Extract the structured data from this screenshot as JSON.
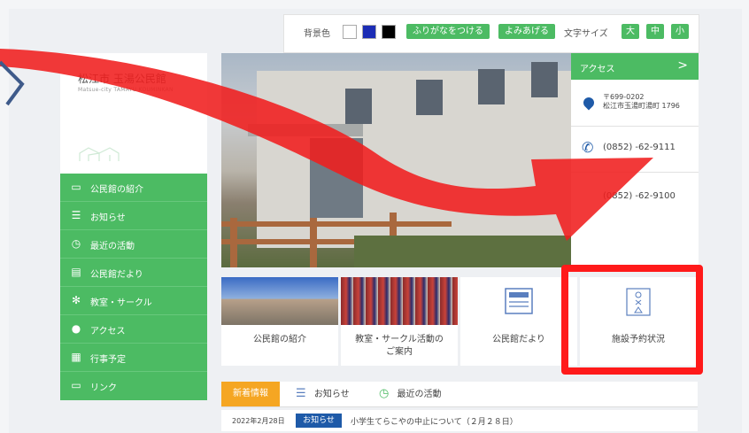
{
  "toolbar": {
    "bg_label": "背景色",
    "furigana_label": "ふりがなをつける",
    "read_aloud_label": "よみあげる",
    "font_size_label": "文字サイズ",
    "size_large": "大",
    "size_medium": "中",
    "size_small": "小",
    "swatches": [
      "#ffffff",
      "#1c2db5",
      "#000000"
    ]
  },
  "site": {
    "title": "松江市 玉湯公民館",
    "subtitle": "Matsue-city TAMAYU KOUMINKAN"
  },
  "sidebar": {
    "items": [
      {
        "label": "公民館の紹介",
        "icon": "building-icon"
      },
      {
        "label": "お知らせ",
        "icon": "notice-icon"
      },
      {
        "label": "最近の活動",
        "icon": "clock-icon"
      },
      {
        "label": "公民館だより",
        "icon": "newsletter-icon"
      },
      {
        "label": "教室・サークル",
        "icon": "circle-icon"
      },
      {
        "label": "アクセス",
        "icon": "location-icon"
      },
      {
        "label": "行事予定",
        "icon": "calendar-icon"
      },
      {
        "label": "リンク",
        "icon": "link-icon"
      }
    ]
  },
  "access": {
    "title": "アクセス",
    "arrow": ">",
    "postal": "〒699-0202",
    "address": "松江市玉湯町湯町 1796",
    "tel": "(0852)  -62-9111",
    "fax": "(0852)  -62-9100"
  },
  "cards": [
    {
      "label": "公民館の紹介"
    },
    {
      "label": "教室・サークル活動の",
      "label2": "ご案内"
    },
    {
      "label": "公民館だより"
    },
    {
      "label": "施設予約状況"
    }
  ],
  "tabs": {
    "active": "新着情報",
    "notice": "お知らせ",
    "activity": "最近の活動"
  },
  "news": [
    {
      "date": "2022年2月28日",
      "badge": "お知らせ",
      "title": "小学生てらこやの中止について（２月２８日）"
    }
  ],
  "colors": {
    "green": "#4cbb63",
    "blue": "#1e5aa8",
    "orange": "#f5a623",
    "annotation_red": "#ff1a1a"
  }
}
